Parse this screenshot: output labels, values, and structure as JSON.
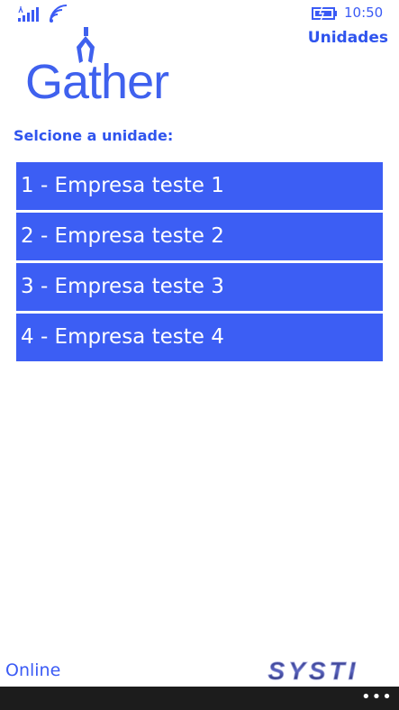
{
  "status_bar": {
    "time": "10:50"
  },
  "header": {
    "title": "Unidades",
    "logo_text": "Gather"
  },
  "main": {
    "prompt": "Selcione a unidade:",
    "units": [
      {
        "label": "1 - Empresa teste 1"
      },
      {
        "label": "2 - Empresa teste 2"
      },
      {
        "label": "3 - Empresa teste 3"
      },
      {
        "label": "4 - Empresa teste 4"
      }
    ]
  },
  "footer": {
    "status": "Online",
    "brand_logo_text": "SYSTI",
    "more_label": "•••"
  },
  "colors": {
    "accent": "#3c5ef4",
    "text_accent": "#2f54ee",
    "app_bar": "#1c1c1c"
  },
  "icons": {
    "signal": "signal-icon",
    "wifi": "wifi-icon",
    "battery": "battery-charging-icon"
  }
}
